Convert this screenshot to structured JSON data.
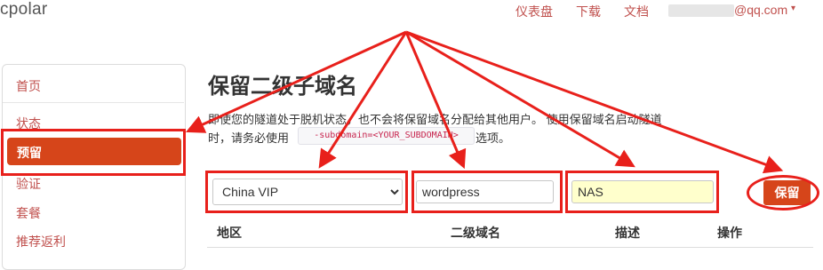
{
  "app": {
    "logo": "cpolar"
  },
  "nav": {
    "links": [
      "仪表盘",
      "下载",
      "文档"
    ],
    "account_email": "@qq.com",
    "account_caret": "▾"
  },
  "sidebar": {
    "items": [
      {
        "label": "首页"
      },
      {
        "label": "状态"
      },
      {
        "label": "预留",
        "active": true
      },
      {
        "label": "验证"
      },
      {
        "label": "套餐"
      },
      {
        "label": "推荐返利"
      }
    ]
  },
  "main": {
    "title": "保留二级子域名",
    "desc_line1": "即使您的隧道处于脱机状态，也不会将保留域名分配给其他用户。 使用保留域名启动隧道",
    "desc_line2_pre": "时，请务必使用",
    "desc_code": "-subdomain=<YOUR_SUBDOMAIN>",
    "desc_line2_post": "选项。",
    "form": {
      "region_selected": "China VIP",
      "subdomain_value": "wordpress",
      "description_value": "NAS",
      "save_label": "保留"
    },
    "table": {
      "headers": [
        "地区",
        "二级域名",
        "描述",
        "操作"
      ]
    }
  },
  "colors": {
    "accent": "#d6451a",
    "link": "#c0504d",
    "annotation": "#e8201b",
    "highlight_field": "#ffffcc"
  }
}
